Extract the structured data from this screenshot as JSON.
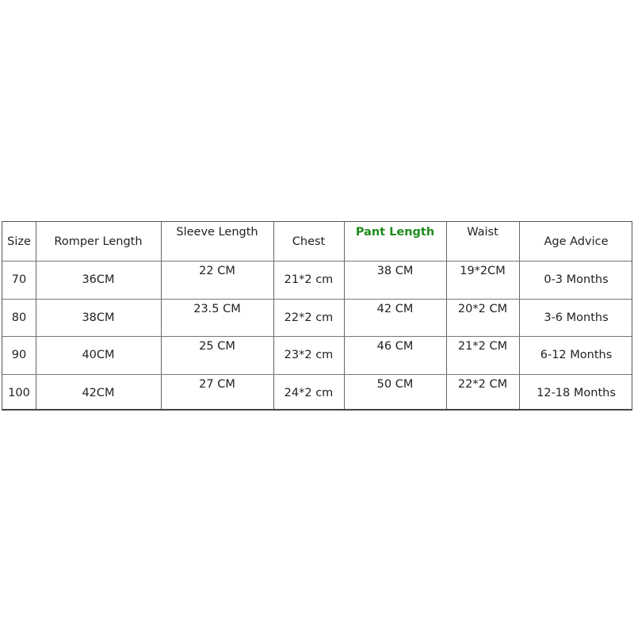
{
  "table": {
    "headers": [
      "Size",
      "Romper Length",
      "Sleeve Length",
      "Chest",
      "Pant Length",
      "Waist",
      "Age Advice"
    ],
    "highlight_header": "Pant Length",
    "highlight_color": "#1e8c1e",
    "rows": [
      [
        "70",
        "36CM",
        "22 CM",
        "21*2 cm",
        "38 CM",
        "19*2CM",
        "0-3 Months"
      ],
      [
        "80",
        "38CM",
        "23.5 CM",
        "22*2 cm",
        "42 CM",
        "20*2 CM",
        "3-6 Months"
      ],
      [
        "90",
        "40CM",
        "25 CM",
        "23*2 cm",
        "46 CM",
        "21*2 CM",
        "6-12 Months"
      ],
      [
        "100",
        "42CM",
        "27 CM",
        "24*2 cm",
        "50 CM",
        "22*2 CM",
        "12-18 Months"
      ]
    ]
  }
}
